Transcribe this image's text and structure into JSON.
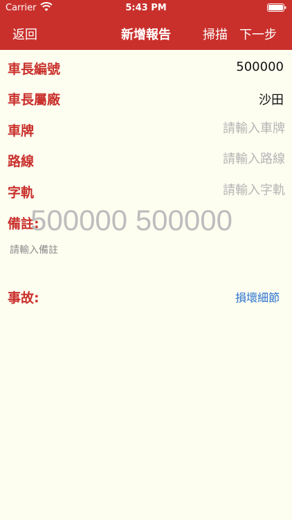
{
  "status_bar": {
    "carrier": "Carrier",
    "time": "5:43 PM",
    "wifi_icon": "wifi-icon",
    "battery_icon": "battery-icon"
  },
  "nav": {
    "back_label": "返回",
    "title": "新增報告",
    "scan_label": "掃描",
    "next_label": "下一步"
  },
  "form": {
    "captain_number": {
      "label": "車長編號",
      "value": "500000"
    },
    "captain_depot": {
      "label": "車長屬廠",
      "value": "沙田"
    },
    "plate": {
      "label": "車牌",
      "placeholder": "請輸入車牌",
      "value": ""
    },
    "route": {
      "label": "路線",
      "placeholder": "請輸入路線",
      "value": ""
    },
    "fleet": {
      "label": "字軌",
      "placeholder": "請輸入字軌",
      "value": ""
    },
    "remarks": {
      "label": "備註:",
      "placeholder": "請輸入備註",
      "overlay_text": "500000 500000"
    },
    "accident": {
      "label": "事故:",
      "link_label": "損壞細節"
    }
  },
  "colors": {
    "brand_red": "#c9302c",
    "background": "#fdfdf0",
    "link_blue": "#2a72d0",
    "placeholder_gray": "#b5b5b5"
  }
}
